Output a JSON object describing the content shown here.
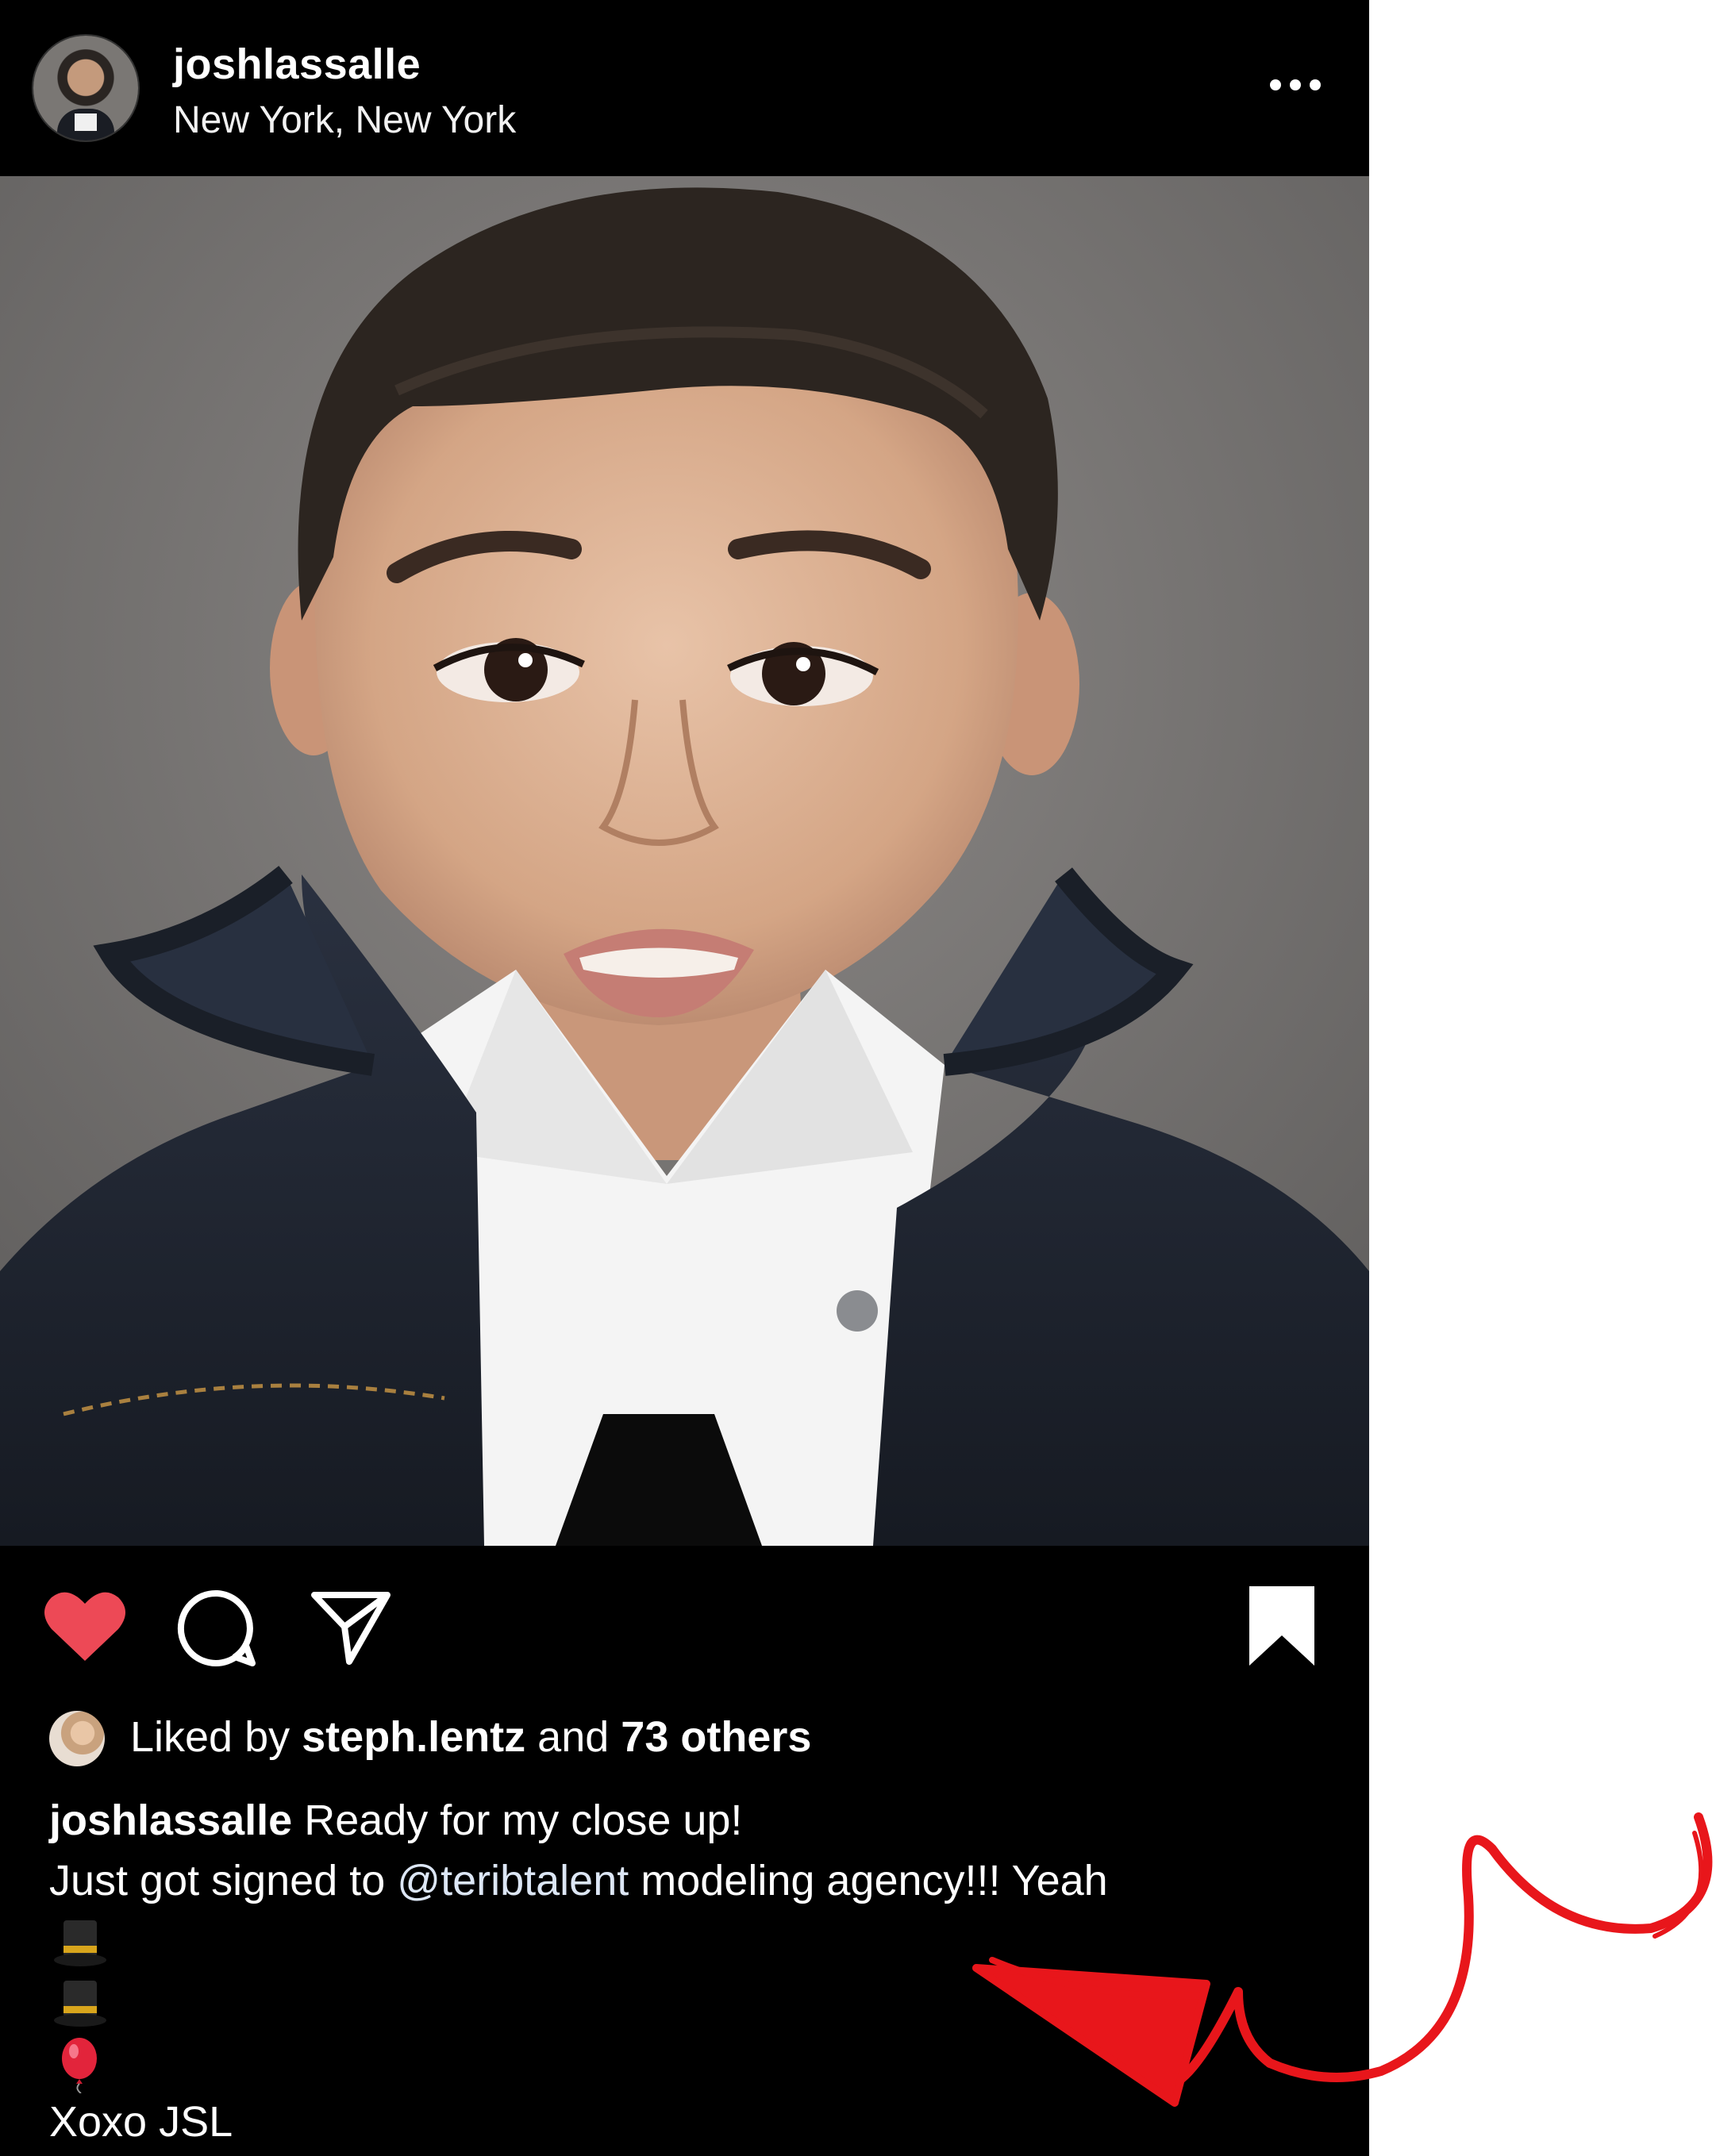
{
  "post": {
    "username": "joshlassalle",
    "location": "New York, New York",
    "more_icon": "more-horizontal-icon"
  },
  "actions": {
    "like_icon": "heart-icon",
    "like_color": "#ed4956",
    "comment_icon": "comment-icon",
    "share_icon": "paper-plane-icon",
    "save_icon": "bookmark-icon"
  },
  "likes": {
    "prefix": "Liked by ",
    "liker": "steph.lentz",
    "middle": " and ",
    "count": "73 others"
  },
  "caption": {
    "author": "joshlassalle",
    "line1": " Ready for my close up!",
    "line2_before": "Just got signed to ",
    "mention": "@teribtalent",
    "line2_after": " modeling agency!!! Yeah",
    "emoji_lines": [
      "🎩",
      "🎩",
      "🎈"
    ],
    "sign_off": "Xoxo JSL"
  },
  "annotation": {
    "color": "#e8161b",
    "icon": "red-arrow-scribble-icon"
  }
}
